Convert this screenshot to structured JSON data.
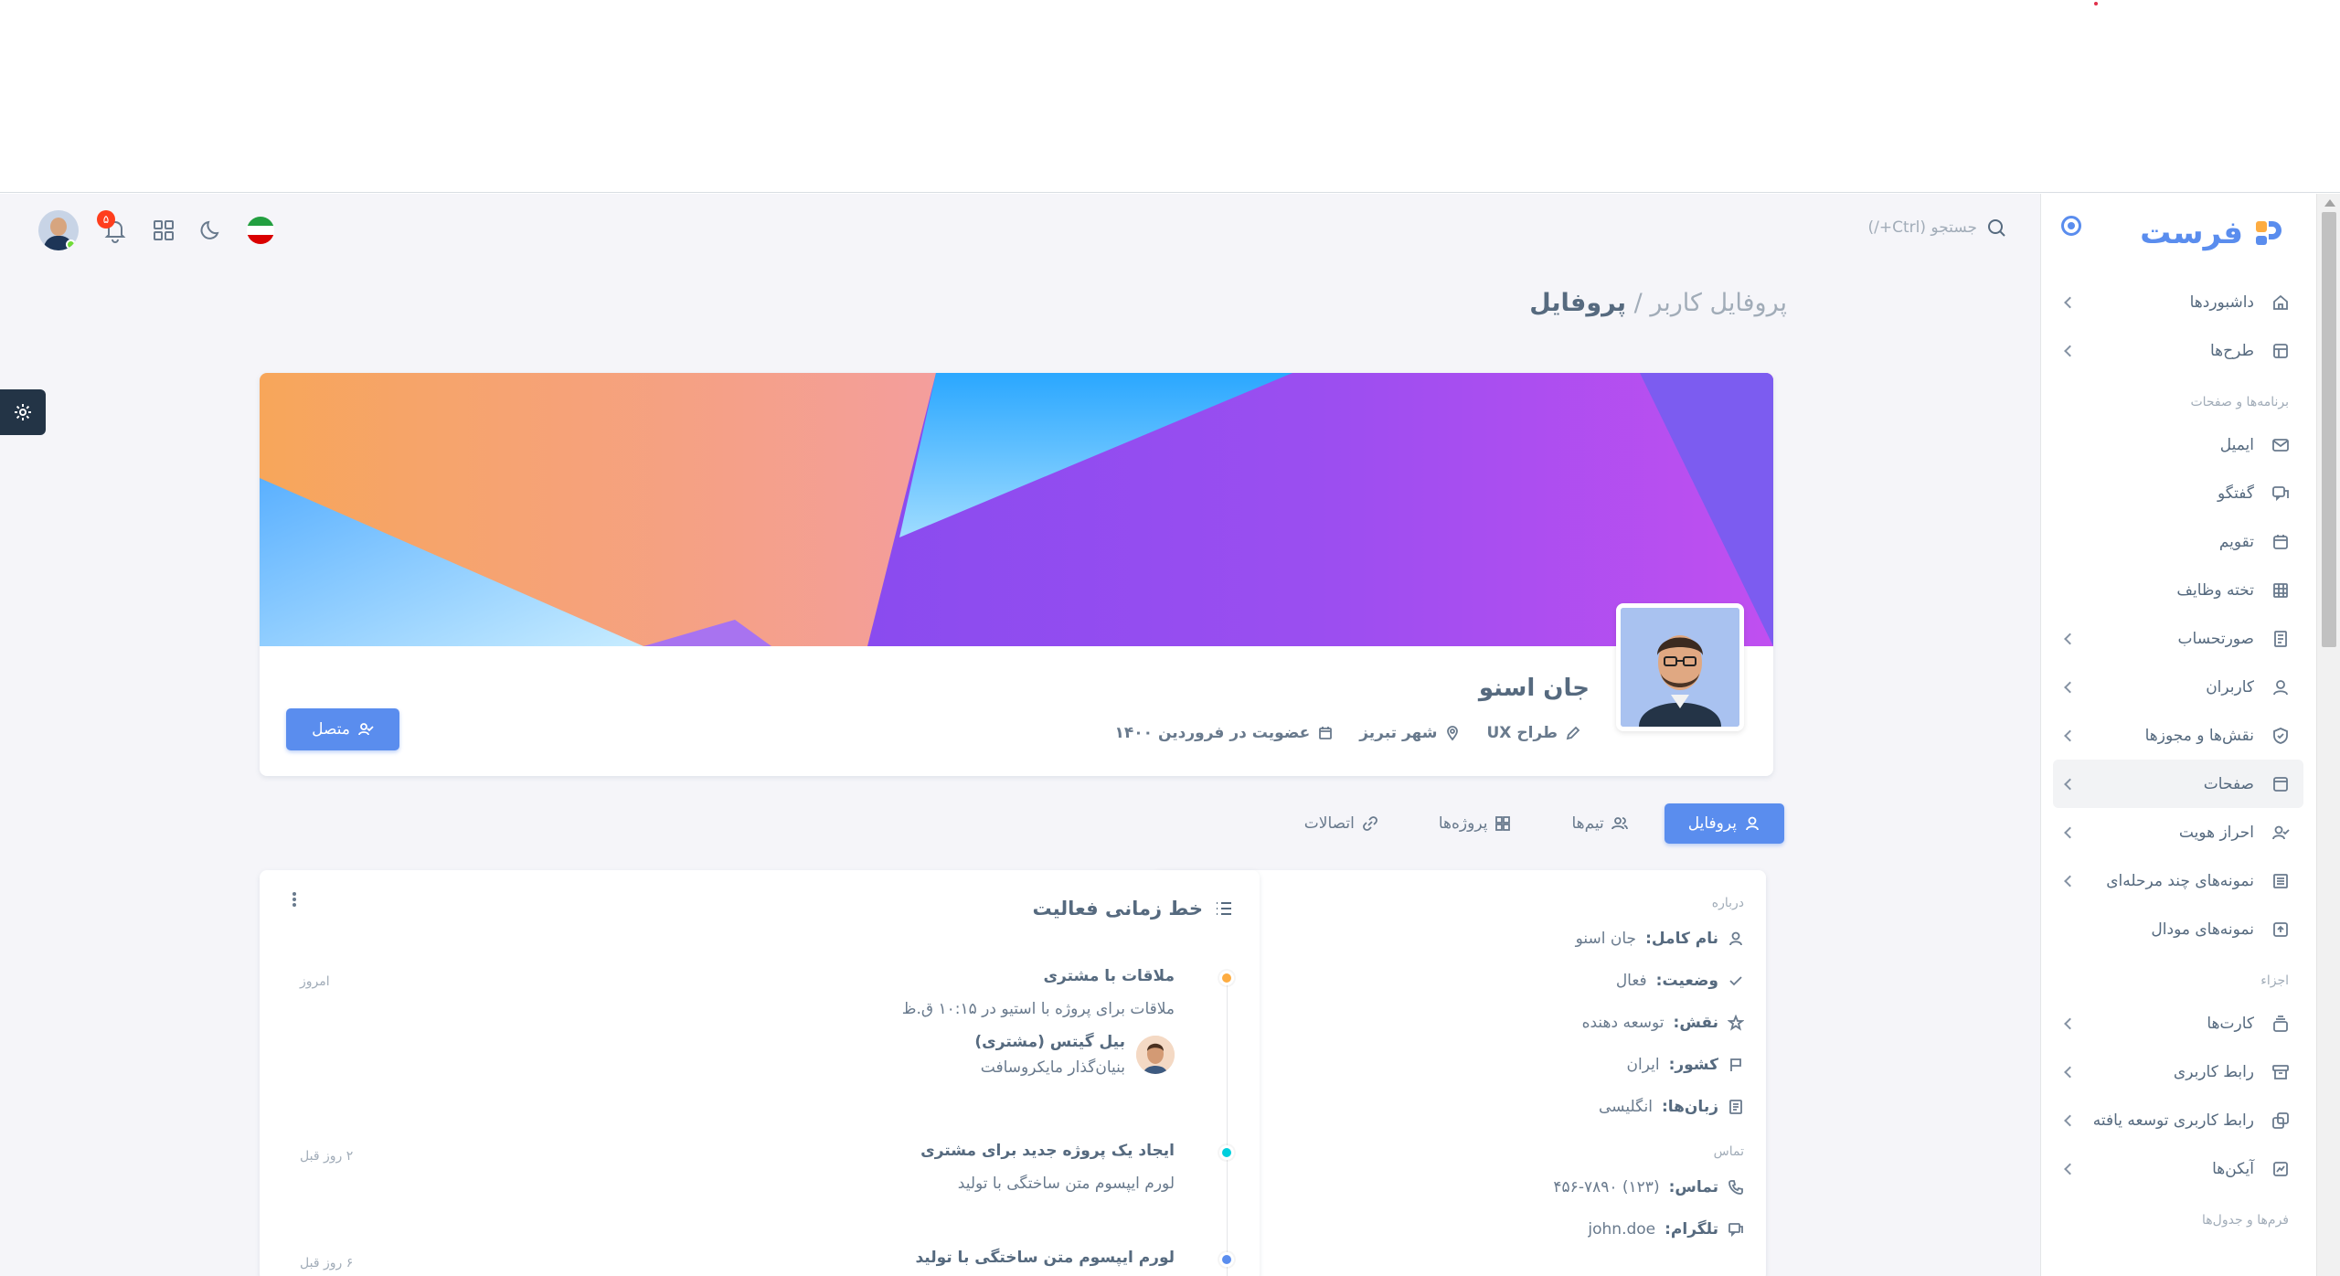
{
  "brand": {
    "name": "فرست"
  },
  "search": {
    "placeholder": "جستجو (Ctrl+/)"
  },
  "topbar": {
    "notification_count": "۵"
  },
  "sidebar": {
    "items": [
      {
        "label": "داشبوردها"
      },
      {
        "label": "طرح‌ها"
      }
    ],
    "section_apps": "برنامه‌ها و صفحات",
    "apps": [
      {
        "label": "ایمیل"
      },
      {
        "label": "گفتگو"
      },
      {
        "label": "تقویم"
      },
      {
        "label": "تخته وظایف"
      },
      {
        "label": "صورتحساب"
      },
      {
        "label": "کاربران"
      },
      {
        "label": "نقش‌ها و مجوزها"
      },
      {
        "label": "صفحات"
      },
      {
        "label": "احراز هویت"
      },
      {
        "label": "نمونه‌های چند مرحله‌ای"
      },
      {
        "label": "نمونه‌های مودال"
      }
    ],
    "section_components": "اجزاء",
    "components": [
      {
        "label": "کارت‌ها"
      },
      {
        "label": "رابط کاربری"
      },
      {
        "label": "رابط کاربری توسعه یافته"
      },
      {
        "label": "آیکن‌ها"
      }
    ],
    "section_forms": "فرم‌ها و جدول‌ها"
  },
  "breadcrumb": {
    "parent": "پروفایل کاربر /",
    "current": "پروفایل"
  },
  "profile": {
    "name": "جان اسنو",
    "job": "طراح UX",
    "city": "شهر تبریز",
    "joined": "عضویت در فروردین ۱۴۰۰",
    "connect_label": "متصل"
  },
  "tabs": [
    {
      "label": "پروفایل"
    },
    {
      "label": "تیم‌ها"
    },
    {
      "label": "پروژه‌ها"
    },
    {
      "label": "اتصالات"
    }
  ],
  "about": {
    "caption": "درباره",
    "rows": [
      {
        "key": "نام کامل:",
        "value": "جان اسنو"
      },
      {
        "key": "وضعیت:",
        "value": "فعال"
      },
      {
        "key": "نقش:",
        "value": "توسعه دهنده"
      },
      {
        "key": "کشور:",
        "value": "ایران"
      },
      {
        "key": "زبان‌ها:",
        "value": "انگلیسی"
      }
    ],
    "contact_caption": "تماس",
    "contact": [
      {
        "key": "تماس:",
        "value": "(۱۲۳) ۴۵۶-۷۸۹۰"
      },
      {
        "key": "تلگرام:",
        "value": "john.doe"
      }
    ]
  },
  "timeline": {
    "title": "خط زمانی فعالیت",
    "events": [
      {
        "title": "ملاقات با مشتری",
        "desc": "ملاقات برای پروژه با استیو در ۱۰:۱۵ ق.ظ",
        "time": "امروز",
        "color": "#fdac41",
        "person": {
          "name": "بیل گیتس (مشتری)",
          "role": "بنیان‌گذار مایکروسافت"
        }
      },
      {
        "title": "ایجاد یک پروژه جدید برای مشتری",
        "desc": "لورم ایپسوم متن ساختگی با تولید",
        "time": "۲ روز قبل",
        "color": "#00cfdd"
      },
      {
        "title": "لورم ایپسوم متن ساختگی با تولید",
        "desc": "",
        "time": "۶ روز قبل",
        "color": "#5a8dee"
      }
    ]
  }
}
